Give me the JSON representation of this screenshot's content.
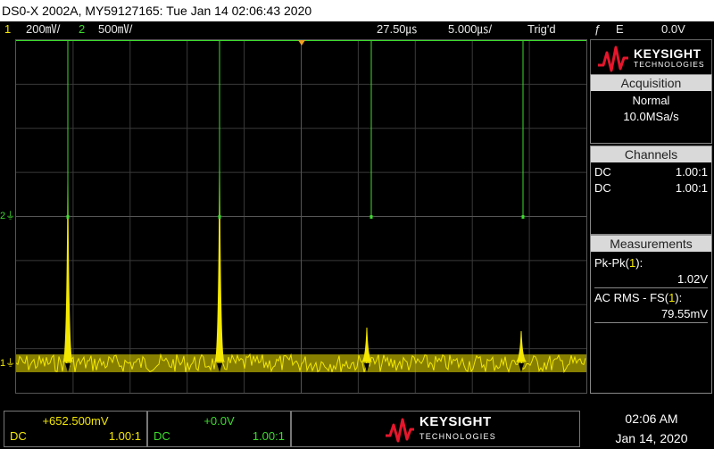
{
  "window_title": "DS0-X 2002A, MY59127165: Tue Jan 14 02:06:43 2020",
  "status": {
    "ch1_num": "1",
    "ch1_scale": "200㎷/",
    "ch2_num": "2",
    "ch2_scale": "500㎷/",
    "time_offset": "27.50㎲",
    "timebase": "5.000㎲/",
    "trigger_state": "Trig'd",
    "trigger_edge_symbol": "ƒ",
    "trigger_mode": "E",
    "trigger_level": "0.0V"
  },
  "markers": {
    "ch2_marker": "2",
    "ch1_marker": "1"
  },
  "brand": {
    "name": "KEYSIGHT",
    "sub": "TECHNOLOGIES",
    "logo_color": "#e6162c"
  },
  "acquisition": {
    "header": "Acquisition",
    "mode": "Normal",
    "rate": "10.0MSa/s"
  },
  "channels": {
    "header": "Channels",
    "rows": [
      {
        "coupling": "DC",
        "probe": "1.00:1",
        "color": "#f4e800"
      },
      {
        "coupling": "DC",
        "probe": "1.00:1",
        "color": "#3bdc2b"
      }
    ]
  },
  "measurements": {
    "header": "Measurements",
    "items": [
      {
        "label_prefix": "Pk-Pk(",
        "channel": "1",
        "label_suffix": "):",
        "value": "1.02V"
      },
      {
        "label_prefix": "AC RMS - FS(",
        "channel": "1",
        "label_suffix": "):",
        "value": "79.55mV"
      }
    ]
  },
  "bottom": {
    "ch1": {
      "offset": "+652.500mV",
      "coupling": "DC",
      "probe": "1.00:1"
    },
    "ch2": {
      "offset": "+0.0V",
      "coupling": "DC",
      "probe": "1.00:1"
    },
    "time": "02:06 AM",
    "date": "Jan 14, 2020"
  },
  "colors": {
    "ch1": "#f4e800",
    "ch2": "#3bdc2b",
    "grid": "#3a3a3a",
    "trigger_marker": "#f0a020"
  }
}
